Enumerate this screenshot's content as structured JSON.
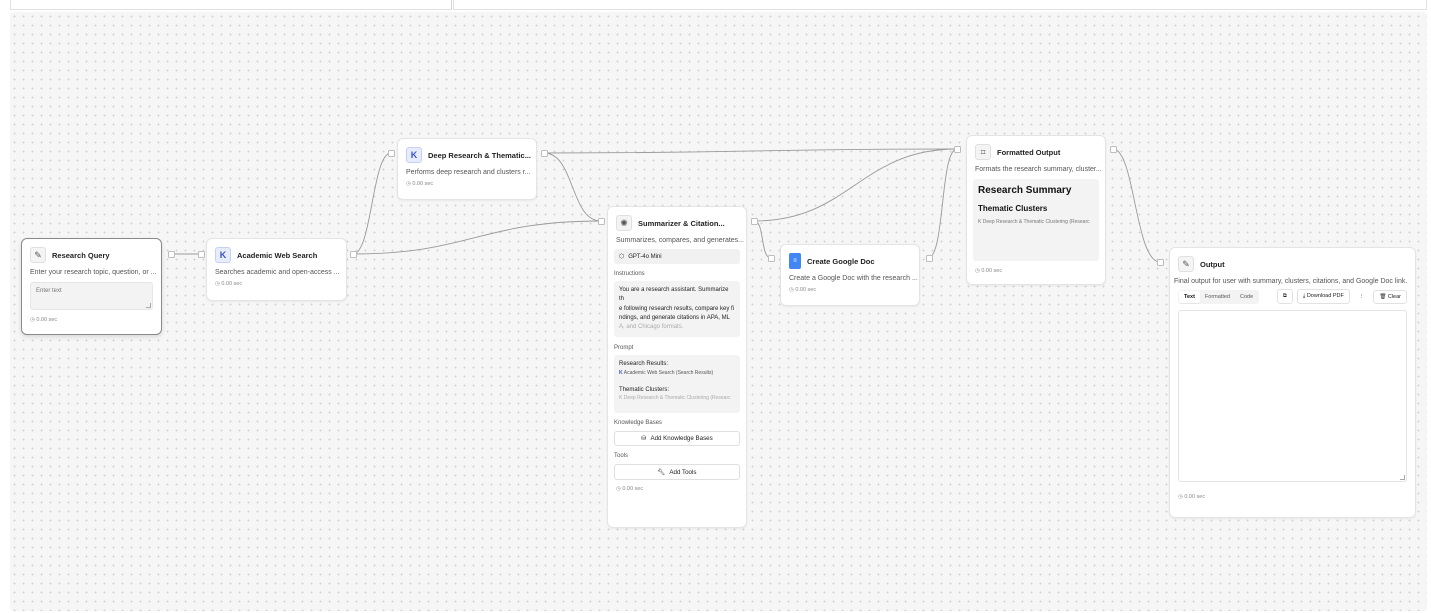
{
  "nodes": {
    "research_query": {
      "title": "Research Query",
      "description": "Enter your research topic, question, or ...",
      "input_placeholder": "Enter text",
      "time": "0.00 sec"
    },
    "academic_search": {
      "title": "Academic Web Search",
      "description": "Searches academic and open-access ...",
      "time": "0.00 sec"
    },
    "deep_research": {
      "title": "Deep Research & Thematic...",
      "description": "Performs deep research and clusters r...",
      "time": "0.00 sec"
    },
    "summarizer": {
      "title": "Summarizer & Citation...",
      "description": "Summarizes, compares, and generates...",
      "model": "GPT-4o Mini",
      "instructions_label": "Instructions",
      "instructions_lines": [
        "You are a research assistant. Summarize th",
        "e following research results, compare key fi",
        "ndings, and generate citations in APA, ML"
      ],
      "instructions_fade": "A, and Chicago formats.",
      "prompt_label": "Prompt",
      "prompt_research_label": "Research Results:",
      "prompt_research_ref": "Academic Web Search (Search Results)",
      "prompt_thematic_label": "Thematic Clusters:",
      "prompt_thematic_ref": "Deep Research & Thematic Clustering (Researc",
      "knowledge_label": "Knowledge Bases",
      "knowledge_button": "Add Knowledge Bases",
      "tools_label": "Tools",
      "tools_button": "Add Tools",
      "time": "0.00 sec"
    },
    "google_doc": {
      "title": "Create Google Doc",
      "description": "Create a Google Doc with the research ...",
      "time": "0.00 sec"
    },
    "formatted_output": {
      "title": "Formatted Output",
      "description": "Formats the research summary, cluster...",
      "preview_h1": "Research Summary",
      "preview_h2": "Thematic Clusters",
      "preview_ref": "Deep Research & Thematic Clustering (Researc",
      "time": "0.00 sec"
    },
    "output": {
      "title": "Output",
      "description": "Final output for user with summary, clusters, citations, and Google Doc link.",
      "tabs": [
        "Text",
        "Formatted",
        "Code"
      ],
      "download_label": "Download PDF",
      "clear_label": "Clear",
      "time": "0.00 sec"
    }
  },
  "icons": {
    "query": "pencil-icon",
    "search": "k-logo-icon",
    "deep": "k-logo-icon",
    "summarizer": "openai-icon",
    "gdoc": "google-doc-icon",
    "formatted": "formatter-icon",
    "output": "pencil-icon"
  },
  "colors": {
    "canvas_bg": "#f6f6f6",
    "edge": "#9a9a9a",
    "k_accent": "#3b52c4",
    "gdoc_blue": "#4285f4"
  }
}
